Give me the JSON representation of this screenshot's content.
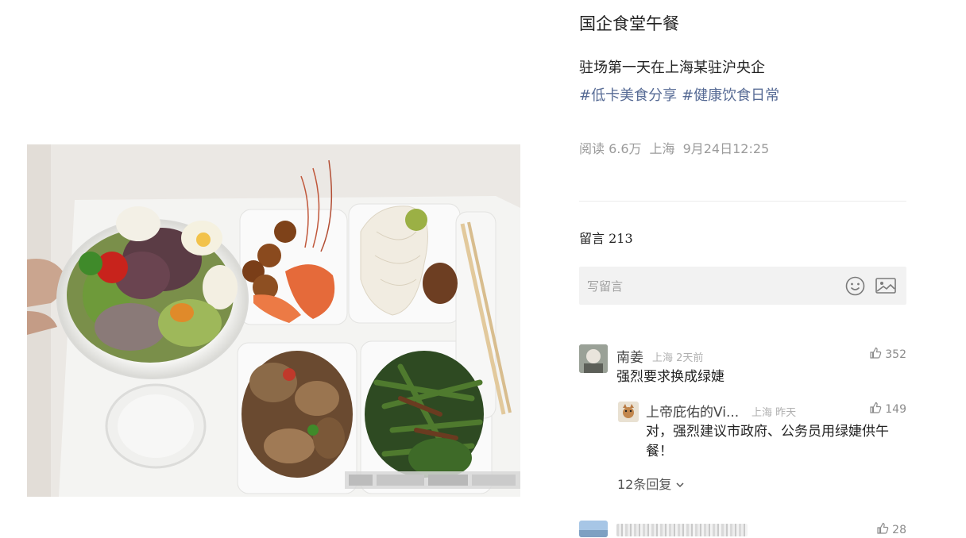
{
  "post": {
    "title": "国企食堂午餐",
    "description": "驻场第一天在上海某驻沪央企",
    "tags": [
      "#低卡美食分享",
      "#健康饮食日常"
    ],
    "reads": "阅读 6.6万",
    "location": "上海",
    "time": "9月24日12:25"
  },
  "comments_section": {
    "label": "留言",
    "count": "213",
    "input_placeholder": "写留言"
  },
  "comments": [
    {
      "name": "南姜",
      "location": "上海",
      "time": "2天前",
      "likes": "352",
      "text": "强烈要求换成绿婕",
      "replies": [
        {
          "name": "上帝庇佑的Vi...",
          "location": "上海",
          "time": "昨天",
          "likes": "149",
          "text": "对，强烈建议市政府、公务员用绿婕供午餐！"
        }
      ],
      "more_replies": "12条回复"
    },
    {
      "likes": "28"
    }
  ],
  "icons": {
    "emoji": "smiley-icon",
    "image": "image-icon",
    "like": "thumbs-up-icon",
    "expand": "chevron-down-icon"
  },
  "colors": {
    "tag": "#576b95",
    "meta": "#9a9a9a",
    "input_bg": "#f2f2f2"
  }
}
